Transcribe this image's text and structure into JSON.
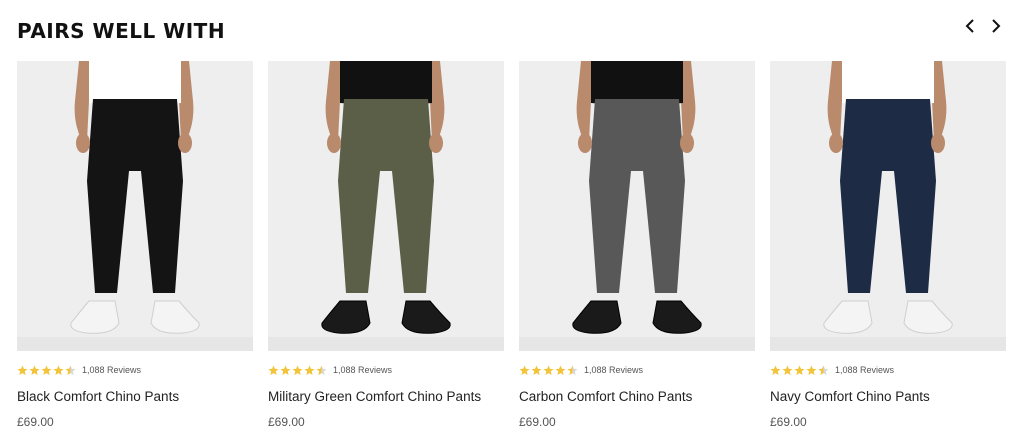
{
  "section": {
    "title": "PAIRS WELL WITH"
  },
  "nav": {
    "prev_icon": "chevron-left-icon",
    "next_icon": "chevron-right-icon"
  },
  "colors": {
    "star": "#f2c43c",
    "star_empty": "#d8d8d8"
  },
  "products": [
    {
      "name": "Black Comfort Chino Pants",
      "price": "£69.00",
      "reviews": "1,088 Reviews",
      "rating": 4.5,
      "pant_color": "#141414",
      "shirt_color": "#ffffff",
      "shoe_color": "#f4f4f4"
    },
    {
      "name": "Military Green Comfort Chino Pants",
      "price": "£69.00",
      "reviews": "1,088 Reviews",
      "rating": 4.5,
      "pant_color": "#5b5f48",
      "shirt_color": "#111111",
      "shoe_color": "#1a1a1a"
    },
    {
      "name": "Carbon Comfort Chino Pants",
      "price": "£69.00",
      "reviews": "1,088 Reviews",
      "rating": 4.5,
      "pant_color": "#585858",
      "shirt_color": "#111111",
      "shoe_color": "#1a1a1a"
    },
    {
      "name": "Navy Comfort Chino Pants",
      "price": "£69.00",
      "reviews": "1,088 Reviews",
      "rating": 4.5,
      "pant_color": "#1e2b45",
      "shirt_color": "#ffffff",
      "shoe_color": "#f4f4f4"
    }
  ]
}
